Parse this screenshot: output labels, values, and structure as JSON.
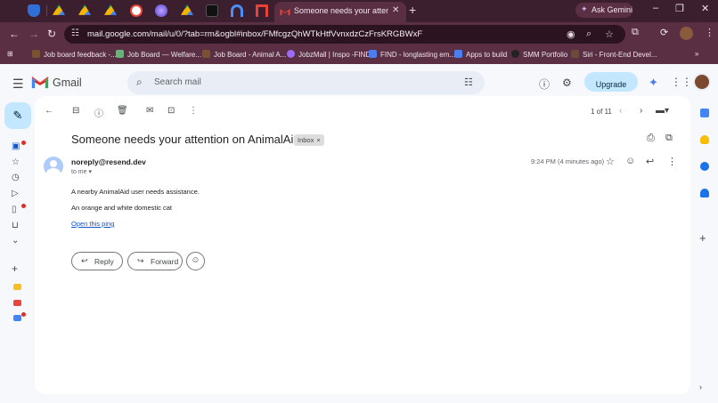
{
  "browser": {
    "active_tab_title": "Someone needs your attention on AnimalAid",
    "new_tab_label": "+",
    "ask_gemini_label": "Ask Gemini",
    "window_controls": [
      "–",
      "❐",
      "✕"
    ],
    "url": "mail.google.com/mail/u/0/?tab=rm&ogbl#inbox/FMfcgzQhWTkHtfVvnxdzCzFrsKRGBWxF"
  },
  "bookmarks": [
    {
      "label": "Job board feedback -...",
      "color": "#7a5230"
    },
    {
      "label": "Job Board — Welfare...",
      "color": "#6bb07a"
    },
    {
      "label": "Job Board - Animal A...",
      "color": "#7a5230"
    },
    {
      "label": "JobzMall | Inspo -FIND",
      "color": "#9b6cf5"
    },
    {
      "label": "FIND - longlasting em...",
      "color": "#4a7ef0"
    },
    {
      "label": "Apps to build",
      "color": "#4a7ef0"
    },
    {
      "label": "SMM Portfolio",
      "color": "#222222"
    },
    {
      "label": "Siri - Front-End Devel...",
      "color": "#6b4a3a"
    }
  ],
  "gmail": {
    "app_name": "Gmail",
    "search_placeholder": "Search mail",
    "upgrade_label": "Upgrade"
  },
  "message": {
    "pager_text": "1 of 11",
    "subject": "Someone needs your attention on AnimalAid",
    "label_chip": "Inbox",
    "label_chip_close": "×",
    "sender": "noreply@resend.dev",
    "to_line": "to me ▾",
    "time": "9:24 PM (4 minutes ago)",
    "body_line_1": "A nearby AnimalAid user needs assistance.",
    "body_line_2": "An orange and white domestic cat",
    "link_text": "Open this ping",
    "reply_label": "Reply",
    "forward_label": "Forward"
  },
  "colors": {
    "browser_frame": "#3c1f2e",
    "toolbar": "#5a2f44",
    "compose_bg": "#c2e7ff",
    "upgrade_bg": "#c2e7ff",
    "link": "#1155cc",
    "notification_dot": "#d93025"
  }
}
